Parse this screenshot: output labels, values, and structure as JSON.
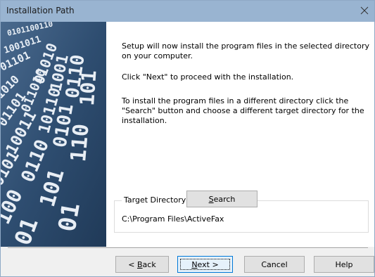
{
  "window": {
    "title": "Installation Path",
    "close_glyph": "✕"
  },
  "content": {
    "paragraph1": "Setup will now install the program files in the selected directory on your computer.",
    "paragraph2": "Click \"Next\" to proceed with the installation.",
    "paragraph3": "To install the program files in a different directory click the \"Search\" button and choose a different target directory for the installation."
  },
  "target_directory": {
    "label": "Target Directory",
    "path": "C:\\Program Files\\ActiveFax",
    "search_button": {
      "accel": "S",
      "rest": "earch"
    }
  },
  "buttons": {
    "back": {
      "prefix": "< ",
      "accel": "B",
      "rest": "ack"
    },
    "next": {
      "accel": "N",
      "rest": "ext >"
    },
    "cancel": "Cancel",
    "help": "Help"
  },
  "banner": {
    "icon": "binary-digits-graphic",
    "color": "#3e5f82"
  },
  "colors": {
    "titlebar": "#99b4d1",
    "default_button_border": "#0078d7"
  }
}
